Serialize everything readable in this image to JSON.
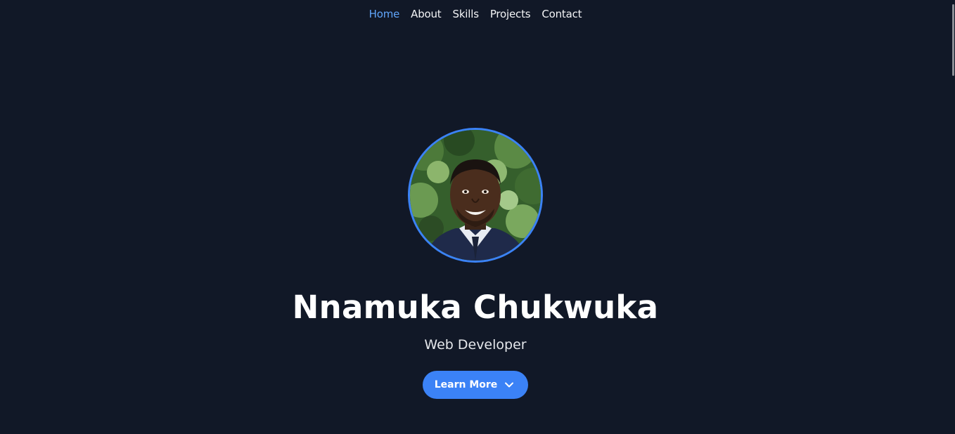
{
  "nav": {
    "items": [
      {
        "label": "Home",
        "active": true
      },
      {
        "label": "About",
        "active": false
      },
      {
        "label": "Skills",
        "active": false
      },
      {
        "label": "Projects",
        "active": false
      },
      {
        "label": "Contact",
        "active": false
      }
    ]
  },
  "hero": {
    "avatar_icon": "profile-photo",
    "name": "Nnamuka Chukwuka",
    "role": "Web Developer",
    "cta_label": "Learn More",
    "cta_icon": "chevron-down-icon"
  },
  "colors": {
    "background": "#111827",
    "accent": "#3b82f6",
    "nav_active": "#60a5fa",
    "text": "#ffffff"
  }
}
